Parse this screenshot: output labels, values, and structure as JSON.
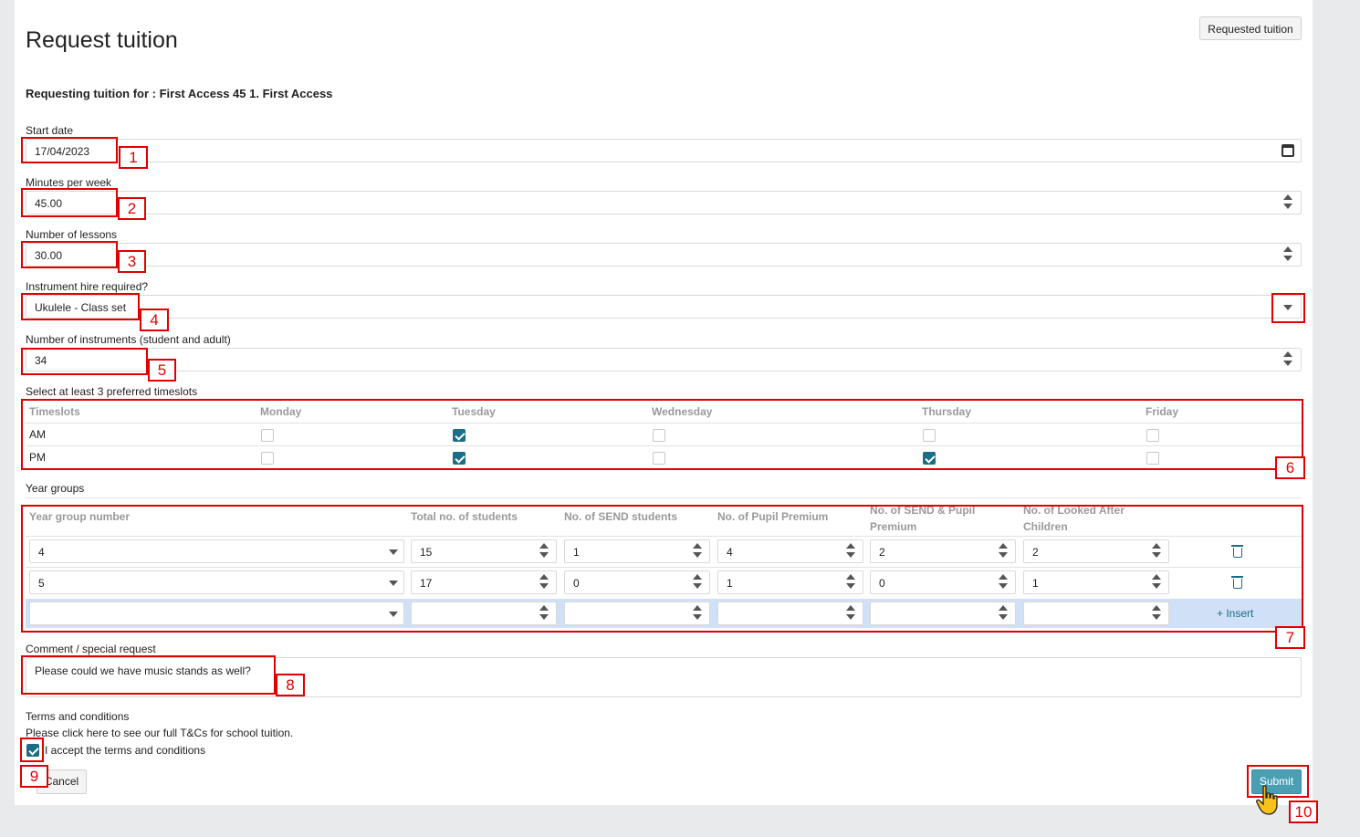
{
  "header": {
    "title": "Request tuition",
    "requested_button": "Requested tuition",
    "subtitle": "Requesting tuition for : First Access 45 1. First Access"
  },
  "form": {
    "start_date": {
      "label": "Start date",
      "value": "17/04/2023"
    },
    "minutes_per_week": {
      "label": "Minutes per week",
      "value": "45.00"
    },
    "number_of_lessons": {
      "label": "Number of lessons",
      "value": "30.00"
    },
    "instrument_hire": {
      "label": "Instrument hire required?",
      "value": "Ukulele - Class set"
    },
    "number_of_instruments": {
      "label": "Number of instruments (student and adult)",
      "value": "34"
    }
  },
  "timeslots": {
    "label": "Select at least 3 preferred timeslots",
    "headers": [
      "Timeslots",
      "Monday",
      "Tuesday",
      "Wednesday",
      "Thursday",
      "Friday"
    ],
    "rows": [
      {
        "name": "AM",
        "checked": [
          false,
          true,
          false,
          false,
          false
        ]
      },
      {
        "name": "PM",
        "checked": [
          false,
          true,
          false,
          true,
          false
        ]
      }
    ]
  },
  "year_groups": {
    "label": "Year groups",
    "headers": [
      "Year group number",
      "Total no. of students",
      "No. of SEND students",
      "No. of Pupil Premium",
      "No. of SEND & Pupil Premium",
      "No. of Looked After Children"
    ],
    "rows": [
      {
        "year": "4",
        "total": "15",
        "send": "1",
        "pupil_premium": "4",
        "send_pp": "2",
        "lac": "2"
      },
      {
        "year": "5",
        "total": "17",
        "send": "0",
        "pupil_premium": "1",
        "send_pp": "0",
        "lac": "1"
      }
    ],
    "insert_label": "+ Insert"
  },
  "comment": {
    "label": "Comment / special request",
    "value": "Please could we have music stands as well?"
  },
  "terms": {
    "label": "Terms and conditions",
    "link_text": "Please click here to see our full T&Cs for school tuition.",
    "accept_label": "I accept the terms and conditions",
    "accepted": true
  },
  "actions": {
    "cancel": "Cancel",
    "submit": "Submit"
  },
  "annotations": [
    "1",
    "2",
    "3",
    "4",
    "5",
    "6",
    "7",
    "8",
    "9",
    "10"
  ],
  "colors": {
    "accent": "#1b6e86",
    "submit": "#4a9fb3",
    "highlight": "#e00000",
    "insert_row": "#cfe0f7"
  }
}
